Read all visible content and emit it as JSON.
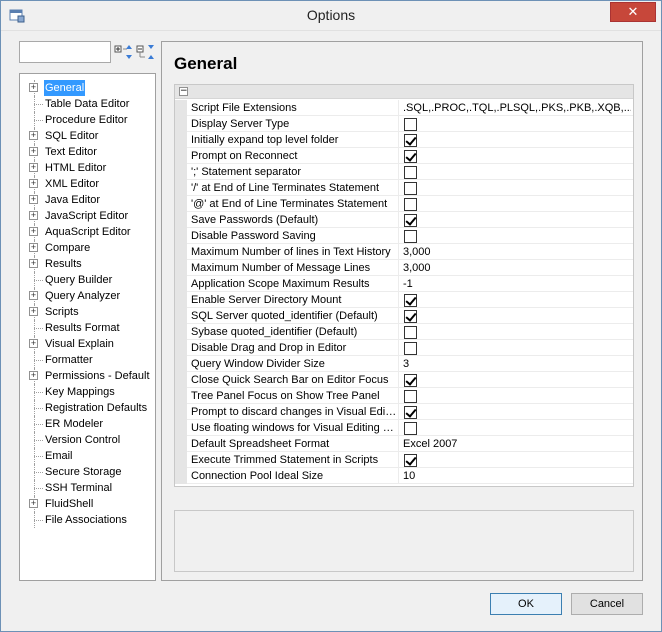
{
  "window": {
    "title": "Options",
    "close_label": "✕"
  },
  "sidebar": {
    "search_value": "",
    "tree": [
      {
        "label": "General",
        "expandable": true,
        "selected": true
      },
      {
        "label": "Table Data Editor",
        "expandable": false
      },
      {
        "label": "Procedure Editor",
        "expandable": false
      },
      {
        "label": "SQL Editor",
        "expandable": true
      },
      {
        "label": "Text Editor",
        "expandable": true
      },
      {
        "label": "HTML Editor",
        "expandable": true
      },
      {
        "label": "XML Editor",
        "expandable": true
      },
      {
        "label": "Java Editor",
        "expandable": true
      },
      {
        "label": "JavaScript Editor",
        "expandable": true
      },
      {
        "label": "AquaScript Editor",
        "expandable": true
      },
      {
        "label": "Compare",
        "expandable": true
      },
      {
        "label": "Results",
        "expandable": true
      },
      {
        "label": "Query Builder",
        "expandable": false
      },
      {
        "label": "Query Analyzer",
        "expandable": true
      },
      {
        "label": "Scripts",
        "expandable": true
      },
      {
        "label": "Results Format",
        "expandable": false
      },
      {
        "label": "Visual Explain",
        "expandable": true
      },
      {
        "label": "Formatter",
        "expandable": false
      },
      {
        "label": "Permissions - Default",
        "expandable": true
      },
      {
        "label": "Key Mappings",
        "expandable": false
      },
      {
        "label": "Registration Defaults",
        "expandable": false
      },
      {
        "label": "ER Modeler",
        "expandable": false
      },
      {
        "label": "Version Control",
        "expandable": false
      },
      {
        "label": "Email",
        "expandable": false
      },
      {
        "label": "Secure Storage",
        "expandable": false
      },
      {
        "label": "SSH Terminal",
        "expandable": false
      },
      {
        "label": "FluidShell",
        "expandable": true
      },
      {
        "label": "File Associations",
        "expandable": false
      }
    ]
  },
  "main": {
    "title": "General",
    "properties": [
      {
        "name": "Script File Extensions",
        "type": "text",
        "value": ".SQL,.PROC,.TQL,.PLSQL,.PKS,.PKB,.XQB,...."
      },
      {
        "name": "Display Server Type",
        "type": "check",
        "checked": false
      },
      {
        "name": "Initially expand top level folder",
        "type": "check",
        "checked": true
      },
      {
        "name": "Prompt on Reconnect",
        "type": "check",
        "checked": true
      },
      {
        "name": "';' Statement separator",
        "type": "check",
        "checked": false
      },
      {
        "name": "'/' at End of Line Terminates Statement",
        "type": "check",
        "checked": false
      },
      {
        "name": "'@' at End of Line Terminates Statement",
        "type": "check",
        "checked": false
      },
      {
        "name": "Save Passwords (Default)",
        "type": "check",
        "checked": true
      },
      {
        "name": "Disable Password Saving",
        "type": "check",
        "checked": false
      },
      {
        "name": "Maximum Number of lines in Text History",
        "type": "text",
        "value": "3,000"
      },
      {
        "name": "Maximum Number of Message Lines",
        "type": "text",
        "value": "3,000"
      },
      {
        "name": "Application Scope Maximum Results",
        "type": "text",
        "value": "-1"
      },
      {
        "name": "Enable Server Directory Mount",
        "type": "check",
        "checked": true
      },
      {
        "name": "SQL Server quoted_identifier (Default)",
        "type": "check",
        "checked": true
      },
      {
        "name": "Sybase quoted_identifier (Default)",
        "type": "check",
        "checked": false
      },
      {
        "name": "Disable Drag and Drop in Editor",
        "type": "check",
        "checked": false
      },
      {
        "name": "Query Window Divider Size",
        "type": "text",
        "value": "3"
      },
      {
        "name": "Close Quick Search Bar on Editor Focus",
        "type": "check",
        "checked": true
      },
      {
        "name": "Tree Panel Focus on Show Tree Panel",
        "type": "check",
        "checked": false
      },
      {
        "name": "Prompt to discard changes in Visual Editin...",
        "type": "check",
        "checked": true
      },
      {
        "name": "Use floating windows for Visual Editing dia...",
        "type": "check",
        "checked": false
      },
      {
        "name": "Default Spreadsheet Format",
        "type": "text",
        "value": "Excel 2007"
      },
      {
        "name": "Execute Trimmed Statement in Scripts",
        "type": "check",
        "checked": true
      },
      {
        "name": "Connection Pool Ideal Size",
        "type": "text",
        "value": "10"
      }
    ]
  },
  "footer": {
    "ok_label": "OK",
    "cancel_label": "Cancel"
  }
}
